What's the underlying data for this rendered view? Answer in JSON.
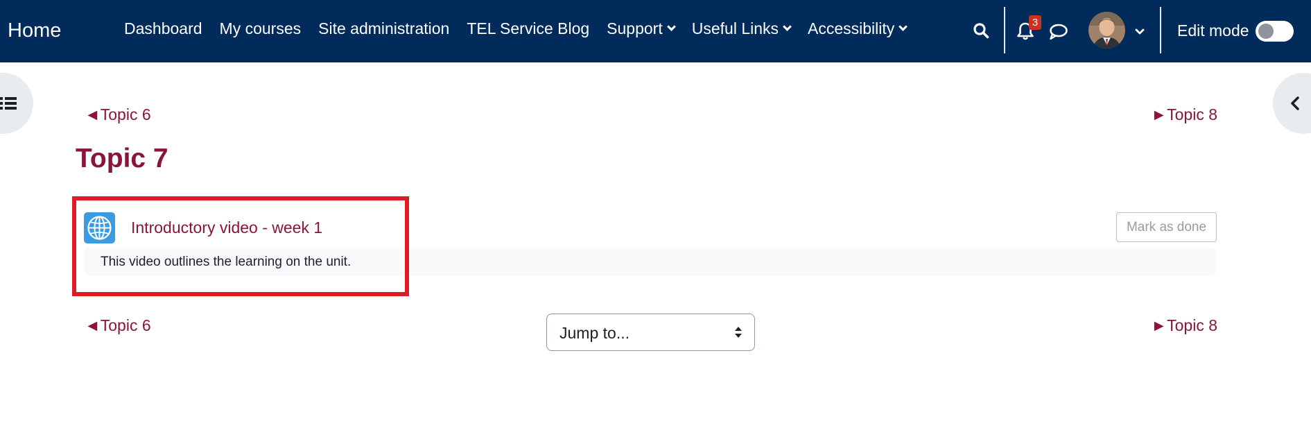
{
  "navbar": {
    "brand": "Home",
    "menu": [
      {
        "label": "Dashboard"
      },
      {
        "label": "My courses"
      },
      {
        "label": "Site administration"
      },
      {
        "label": "TEL Service Blog"
      },
      {
        "label": "Support"
      },
      {
        "label": "Useful Links"
      },
      {
        "label": "Accessibility"
      }
    ],
    "notification_count": "3",
    "edit_mode_label": "Edit mode",
    "icons": [
      "search-icon",
      "bell-icon",
      "chat-icon",
      "chevron-down-icon"
    ]
  },
  "section_nav": {
    "prev": "◄Topic 6",
    "next": "►Topic 8"
  },
  "topic": {
    "title": "Topic 7"
  },
  "activity": {
    "icon": "globe-icon",
    "name": "Introductory video - week 1",
    "mark_done_label": "Mark as done",
    "description": "This video outlines the learning on the unit."
  },
  "jump_to": {
    "selected": "Jump to..."
  },
  "colors": {
    "navbar": "#012b5a",
    "accent": "#8a1538",
    "highlight": "#e01b24",
    "activity_icon": "#399be2"
  }
}
